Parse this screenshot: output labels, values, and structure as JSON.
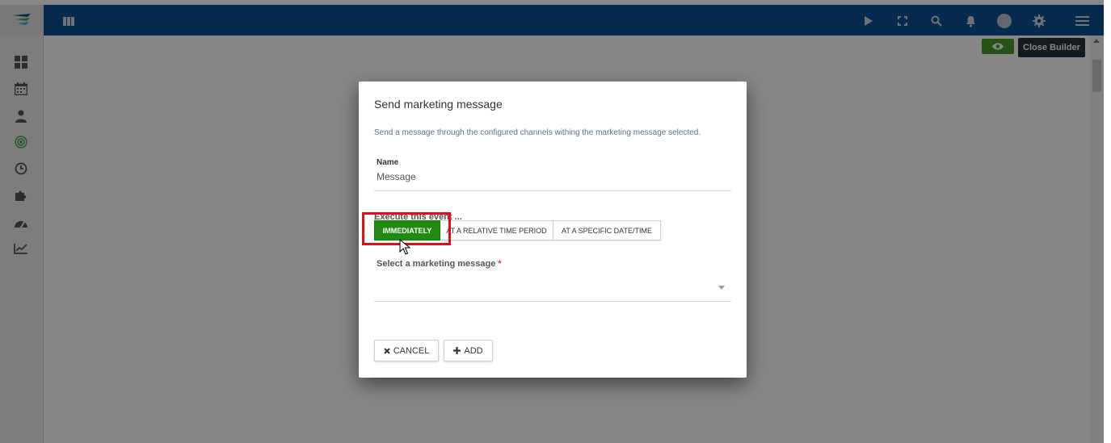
{
  "toolbar": {
    "close_builder_label": "Close Builder"
  },
  "modal": {
    "title": "Send marketing message",
    "description": "Send a message through the configured channels withing the marketing message selected.",
    "name_label": "Name",
    "name_value": "Message",
    "execute_label": "Execute this event ...",
    "timing_options": [
      "IMMEDIATELY",
      "AT A RELATIVE TIME PERIOD",
      "AT A SPECIFIC DATE/TIME"
    ],
    "selected_timing": "IMMEDIATELY",
    "select_label": "Select a marketing message",
    "required_mark": "*",
    "cancel_label": "CANCEL",
    "add_label": "ADD"
  },
  "icons": {
    "topbar": [
      "play-icon",
      "fullscreen-icon",
      "search-icon",
      "bell-icon",
      "avatar",
      "gear-icon",
      "menu-icon"
    ],
    "sidebar": [
      "dashboard-icon",
      "calendar-icon",
      "user-icon",
      "target-icon",
      "clock-icon",
      "puzzle-icon",
      "gauge-icon",
      "chart-line-icon"
    ]
  },
  "colors": {
    "topbar": "#0f4c96",
    "accent_green": "#218a10",
    "highlight": "#e10f14",
    "active_sidebar": "#4caf50",
    "close_builder_bg": "#263238"
  }
}
